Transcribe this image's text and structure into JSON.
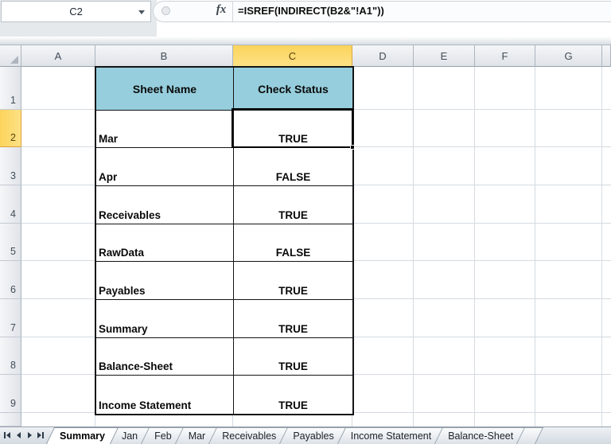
{
  "formula_bar": {
    "name_box_value": "C2",
    "formula": "=ISREF(INDIRECT(B2&\"!A1\"))",
    "fx_label": "fx"
  },
  "grid": {
    "column_headers": [
      "A",
      "B",
      "C",
      "D",
      "E",
      "F",
      "G"
    ],
    "row_headers": [
      "1",
      "2",
      "3",
      "4",
      "5",
      "6",
      "7",
      "8",
      "9"
    ],
    "selected_cell": "C2",
    "selected_column": "C",
    "selected_row": "2"
  },
  "table": {
    "headers": {
      "sheet_name": "Sheet Name",
      "check_status": "Check Status"
    },
    "rows": [
      {
        "sheet_name": "Mar",
        "check_status": "TRUE"
      },
      {
        "sheet_name": "Apr",
        "check_status": "FALSE"
      },
      {
        "sheet_name": "Receivables",
        "check_status": "TRUE"
      },
      {
        "sheet_name": "RawData",
        "check_status": "FALSE"
      },
      {
        "sheet_name": "Payables",
        "check_status": "TRUE"
      },
      {
        "sheet_name": "Summary",
        "check_status": "TRUE"
      },
      {
        "sheet_name": "Balance-Sheet",
        "check_status": "TRUE"
      },
      {
        "sheet_name": "Income Statement",
        "check_status": "TRUE"
      }
    ]
  },
  "sheet_tabs": {
    "active_tab": "Summary",
    "tabs": [
      "Summary",
      "Jan",
      "Feb",
      "Mar",
      "Receivables",
      "Payables",
      "Income Statement",
      "Balance-Sheet"
    ]
  },
  "icons": {
    "name_box_dropdown": "chevron-down",
    "insert_function": "fx",
    "formula_bar_cap": "circle-gripper",
    "select_all": "corner-triangle",
    "tab_nav": [
      "first-sheet",
      "previous-sheet",
      "next-sheet",
      "last-sheet"
    ]
  },
  "colors": {
    "table_header_fill": "#96CEDD",
    "selected_header_fill": "#FCD45C",
    "gridline": "#D5DBE2",
    "selection_border": "#000000",
    "chrome_gray": "#E5E9EC"
  }
}
